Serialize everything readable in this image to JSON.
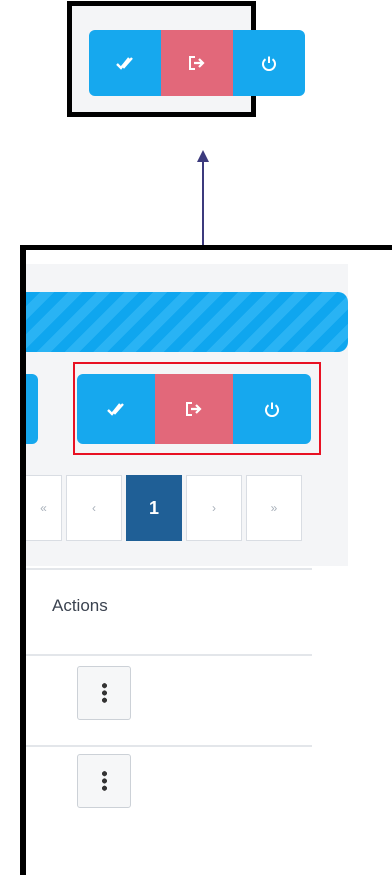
{
  "zoom": {
    "buttons": [
      {
        "icon": "double-check-icon",
        "color": "#16a8ee"
      },
      {
        "icon": "sign-out-icon",
        "color": "#e2687a"
      },
      {
        "icon": "power-icon",
        "color": "#16a8ee"
      }
    ]
  },
  "colors": {
    "accent": "#16a8ee",
    "danger": "#e2687a",
    "pager_active": "#1f5f96",
    "highlight": "#e81123"
  },
  "toolbar": {
    "buttons": [
      {
        "icon": "double-check-icon"
      },
      {
        "icon": "sign-out-icon"
      },
      {
        "icon": "power-icon"
      }
    ]
  },
  "pagination": {
    "first": "«",
    "prev": "‹",
    "current": "1",
    "next": "›",
    "last": "»"
  },
  "table": {
    "header_actions": "Actions",
    "rows": [
      {
        "actions_icon": "vertical-dots-icon"
      },
      {
        "actions_icon": "vertical-dots-icon"
      }
    ]
  }
}
